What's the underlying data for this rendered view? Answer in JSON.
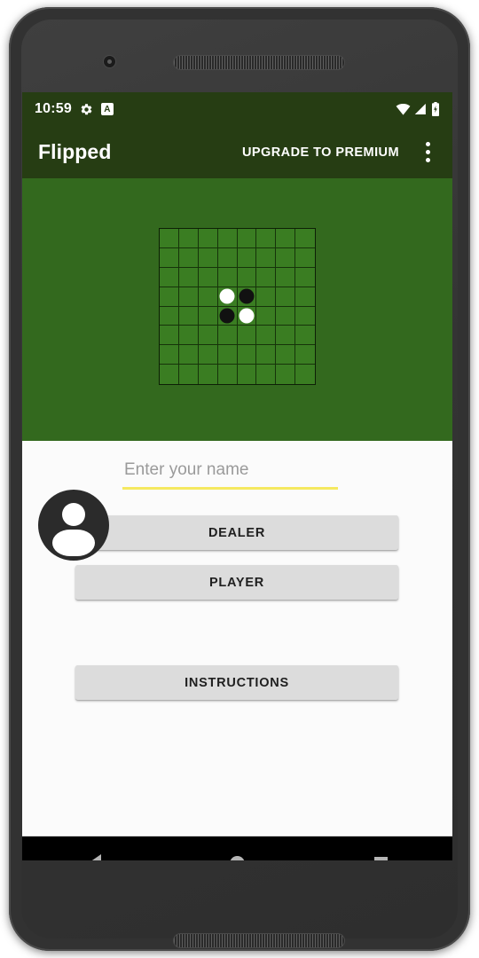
{
  "device": {
    "camera_icon": "front-camera-icon",
    "earpiece_icon": "earpiece-speaker-icon",
    "bottom_speaker_icon": "bottom-speaker-icon"
  },
  "status_bar": {
    "time": "10:59",
    "gear_icon": "gear-icon",
    "badge_label": "A",
    "wifi_icon": "wifi-icon",
    "signal_icon": "cellular-signal-icon",
    "battery_icon": "battery-icon",
    "background_color": "#263D13",
    "foreground_color": "#FFFFFF"
  },
  "app_bar": {
    "title": "Flipped",
    "upgrade_label": "UPGRADE TO PREMIUM",
    "overflow_icon": "more-vertical-icon",
    "background_color": "#263D13"
  },
  "game_area": {
    "background_color": "#33691E",
    "board": {
      "rows": 8,
      "columns": 8,
      "cell_color": "#3A7D22",
      "grid_line_color": "#16330A",
      "discs": [
        {
          "row": 4,
          "col": 4,
          "color": "white"
        },
        {
          "row": 4,
          "col": 5,
          "color": "black"
        },
        {
          "row": 5,
          "col": 4,
          "color": "black"
        },
        {
          "row": 5,
          "col": 5,
          "color": "white"
        }
      ]
    }
  },
  "avatar": {
    "icon": "person-avatar-icon",
    "background_color": "#2B2B2B",
    "figure_color": "#FFFFFF"
  },
  "form": {
    "name_input": {
      "value": "",
      "placeholder": "Enter your name",
      "underline_color": "#F5E960"
    },
    "buttons": [
      {
        "label": "DEALER",
        "name": "dealer-button"
      },
      {
        "label": "PLAYER",
        "name": "player-button"
      },
      {
        "label": "INSTRUCTIONS",
        "name": "instructions-button"
      }
    ],
    "button_color": "#DCDCDC",
    "background_color": "#FBFBFB"
  },
  "nav_bar": {
    "back_icon": "back-triangle-icon",
    "home_icon": "home-circle-icon",
    "recents_icon": "recents-square-icon",
    "background_color": "#000000",
    "icon_color": "#B5B5B5"
  }
}
